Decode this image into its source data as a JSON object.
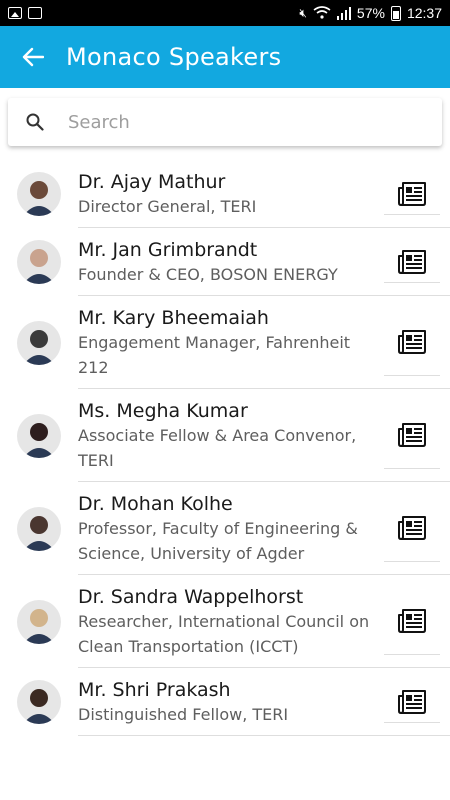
{
  "status_bar": {
    "battery": "57%",
    "time": "12:37"
  },
  "app_bar": {
    "title": "Monaco Speakers"
  },
  "search": {
    "placeholder": "Search"
  },
  "speakers": [
    {
      "name": "Dr. Ajay Mathur",
      "role": "Director General, TERI",
      "avatar_color": "#6b4a3a"
    },
    {
      "name": "Mr. Jan Grimbrandt",
      "role": "Founder & CEO, BOSON ENERGY",
      "avatar_color": "#c9a38e"
    },
    {
      "name": "Mr. Kary Bheemaiah",
      "role": "Engagement Manager, Fahrenheit 212",
      "avatar_color": "#3a3a3a"
    },
    {
      "name": "Ms. Megha Kumar",
      "role": "Associate Fellow & Area Convenor, TERI",
      "avatar_color": "#2e1e1e"
    },
    {
      "name": "Dr. Mohan Kolhe",
      "role": "Professor, Faculty of Engineering & Science, University of Agder",
      "avatar_color": "#4a3630"
    },
    {
      "name": "Dr. Sandra Wappelhorst",
      "role": "Researcher, International Council on Clean Transportation (ICCT)",
      "avatar_color": "#d2b48c"
    },
    {
      "name": "Mr. Shri Prakash",
      "role": "Distinguished Fellow, TERI",
      "avatar_color": "#3b2a22"
    }
  ],
  "colors": {
    "app_bar": "#12a8e0"
  }
}
